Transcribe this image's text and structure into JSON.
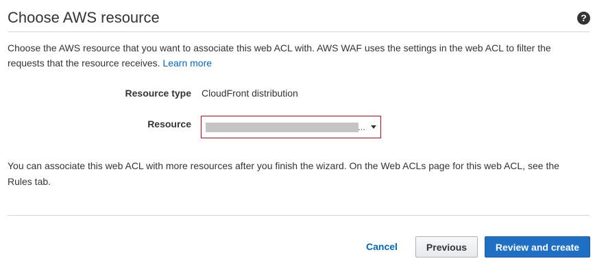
{
  "header": {
    "title": "Choose AWS resource",
    "help_icon": "question-circle-icon",
    "help_glyph": "?"
  },
  "description": {
    "text": "Choose the AWS resource that you want to associate this web ACL with. AWS WAF uses the settings in the web ACL to filter the requests that the resource receives.",
    "link_label": "Learn more"
  },
  "form": {
    "resource_type": {
      "label": "Resource type",
      "value": "CloudFront distribution"
    },
    "resource": {
      "label": "Resource",
      "selected_value_truncation": "...",
      "selected_value_redacted": true,
      "border_color": "#d0021b"
    }
  },
  "note": {
    "text": "You can associate this web ACL with more resources after you finish the wizard. On the Web ACLs page for this web ACL, see the Rules tab."
  },
  "footer": {
    "cancel_label": "Cancel",
    "previous_label": "Previous",
    "review_label": "Review and create"
  },
  "colors": {
    "link": "#0066c0",
    "primary_button": "#1f6fc5",
    "error_border": "#d0021b"
  }
}
